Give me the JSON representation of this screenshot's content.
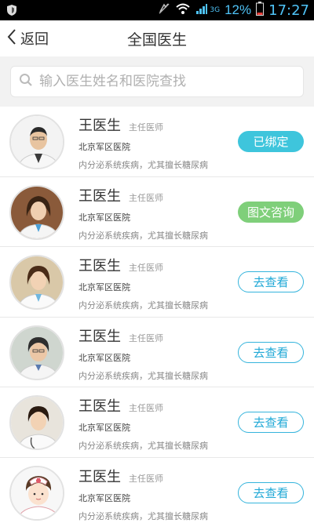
{
  "status_bar": {
    "signal_label": "3G",
    "battery": "12%",
    "time": "17:27"
  },
  "nav": {
    "back_label": "返回",
    "title": "全国医生"
  },
  "search": {
    "placeholder": "输入医生姓名和医院查找"
  },
  "doctors": [
    {
      "name": "王医生",
      "title": "主任医师",
      "hospital": "北京军区医院",
      "specialty": "内分泌系统疾病，尤其擅长糖尿病",
      "action": "已绑定",
      "action_type": "bound",
      "avatar": "male-doctor"
    },
    {
      "name": "王医生",
      "title": "主任医师",
      "hospital": "北京军区医院",
      "specialty": "内分泌系统疾病，尤其擅长糖尿病",
      "action": "图文咨询",
      "action_type": "consult",
      "avatar": "female-doctor"
    },
    {
      "name": "王医生",
      "title": "主任医师",
      "hospital": "北京军区医院",
      "specialty": "内分泌系统疾病，尤其擅长糖尿病",
      "action": "去查看",
      "action_type": "view",
      "avatar": "female-doctor"
    },
    {
      "name": "王医生",
      "title": "主任医师",
      "hospital": "北京军区医院",
      "specialty": "内分泌系统疾病，尤其擅长糖尿病",
      "action": "去查看",
      "action_type": "view",
      "avatar": "senior-female-doctor"
    },
    {
      "name": "王医生",
      "title": "主任医师",
      "hospital": "北京军区医院",
      "specialty": "内分泌系统疾病，尤其擅长糖尿病",
      "action": "去查看",
      "action_type": "view",
      "avatar": "female-doctor"
    },
    {
      "name": "王医生",
      "title": "主任医师",
      "hospital": "北京军区医院",
      "specialty": "内分泌系统疾病，尤其擅长糖尿病",
      "action": "去查看",
      "action_type": "view",
      "avatar": "nurse-cartoon"
    }
  ],
  "colors": {
    "bound": "#3ec5dc",
    "consult": "#7fcf7a",
    "view_border": "#35b4dc"
  }
}
